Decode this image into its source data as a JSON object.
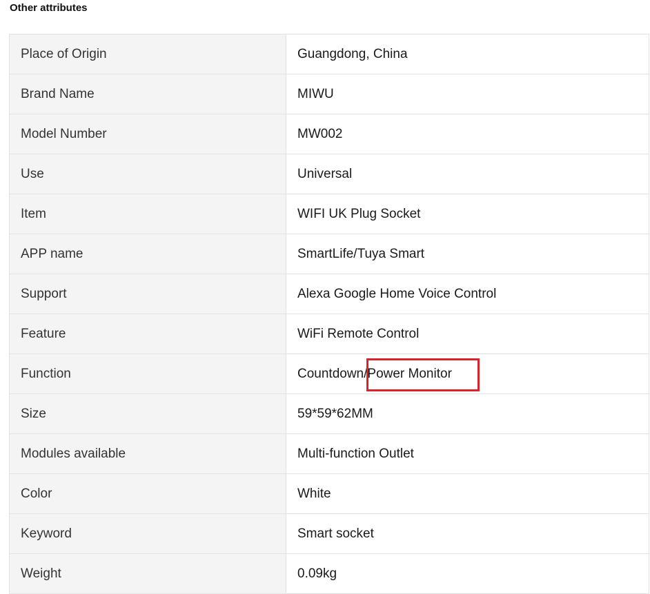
{
  "section": {
    "title": "Other attributes"
  },
  "attributes": [
    {
      "label": "Place of Origin",
      "value": "Guangdong, China"
    },
    {
      "label": "Brand Name",
      "value": "MIWU"
    },
    {
      "label": "Model Number",
      "value": "MW002"
    },
    {
      "label": "Use",
      "value": "Universal"
    },
    {
      "label": "Item",
      "value": "WIFI UK Plug Socket"
    },
    {
      "label": "APP name",
      "value": "SmartLife/Tuya Smart"
    },
    {
      "label": "Support",
      "value": "Alexa Google Home Voice Control"
    },
    {
      "label": "Feature",
      "value": "WiFi Remote Control"
    },
    {
      "label": "Function",
      "value": "Countdown/Power Monitor"
    },
    {
      "label": "Size",
      "value": "59*59*62MM"
    },
    {
      "label": "Modules available",
      "value": "Multi-function Outlet"
    },
    {
      "label": "Color",
      "value": "White"
    },
    {
      "label": "Keyword",
      "value": "Smart socket"
    },
    {
      "label": "Weight",
      "value": "0.09kg"
    }
  ],
  "colors": {
    "label_bg": "#f4f4f4",
    "border": "#e3e3e3",
    "highlight": "#d9232a"
  }
}
